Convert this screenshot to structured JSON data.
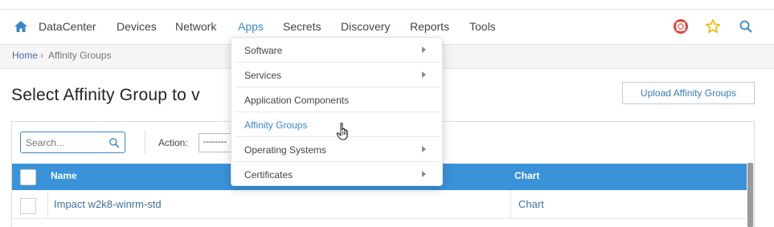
{
  "nav": {
    "home_icon": "home-icon",
    "items": [
      {
        "label": "DataCenter"
      },
      {
        "label": "Devices"
      },
      {
        "label": "Network"
      },
      {
        "label": "Apps",
        "active": true
      },
      {
        "label": "Secrets"
      },
      {
        "label": "Discovery"
      },
      {
        "label": "Reports"
      },
      {
        "label": "Tools"
      }
    ],
    "right_icons": [
      "lifebuoy-icon",
      "star-icon",
      "search-icon"
    ]
  },
  "breadcrumb": {
    "home": "Home",
    "separator": "›",
    "current": "Affinity Groups"
  },
  "page": {
    "title": "Select Affinity Group to v",
    "upload_button": "Upload Affinity Groups"
  },
  "toolbar": {
    "search_placeholder": "Search...",
    "search_value": "",
    "action_label": "Action:",
    "action_value": "--------"
  },
  "table": {
    "headers": {
      "name": "Name",
      "chart": "Chart"
    },
    "rows": [
      {
        "name": "Impact w2k8-winrm-std",
        "chart": "Chart"
      }
    ]
  },
  "apps_menu": {
    "items": [
      {
        "label": "Software",
        "submenu": true
      },
      {
        "label": "Services",
        "submenu": true
      },
      {
        "label": "Application Components",
        "submenu": false
      },
      {
        "label": "Affinity Groups",
        "submenu": false,
        "hovered": true
      },
      {
        "label": "Operating Systems",
        "submenu": true
      },
      {
        "label": "Certificates",
        "submenu": true
      }
    ]
  },
  "colors": {
    "accent": "#3a87c8",
    "header_blue": "#3a92d8",
    "link": "#3f6fa0",
    "lifebuoy": "#e0443a",
    "star": "#f2b700"
  }
}
